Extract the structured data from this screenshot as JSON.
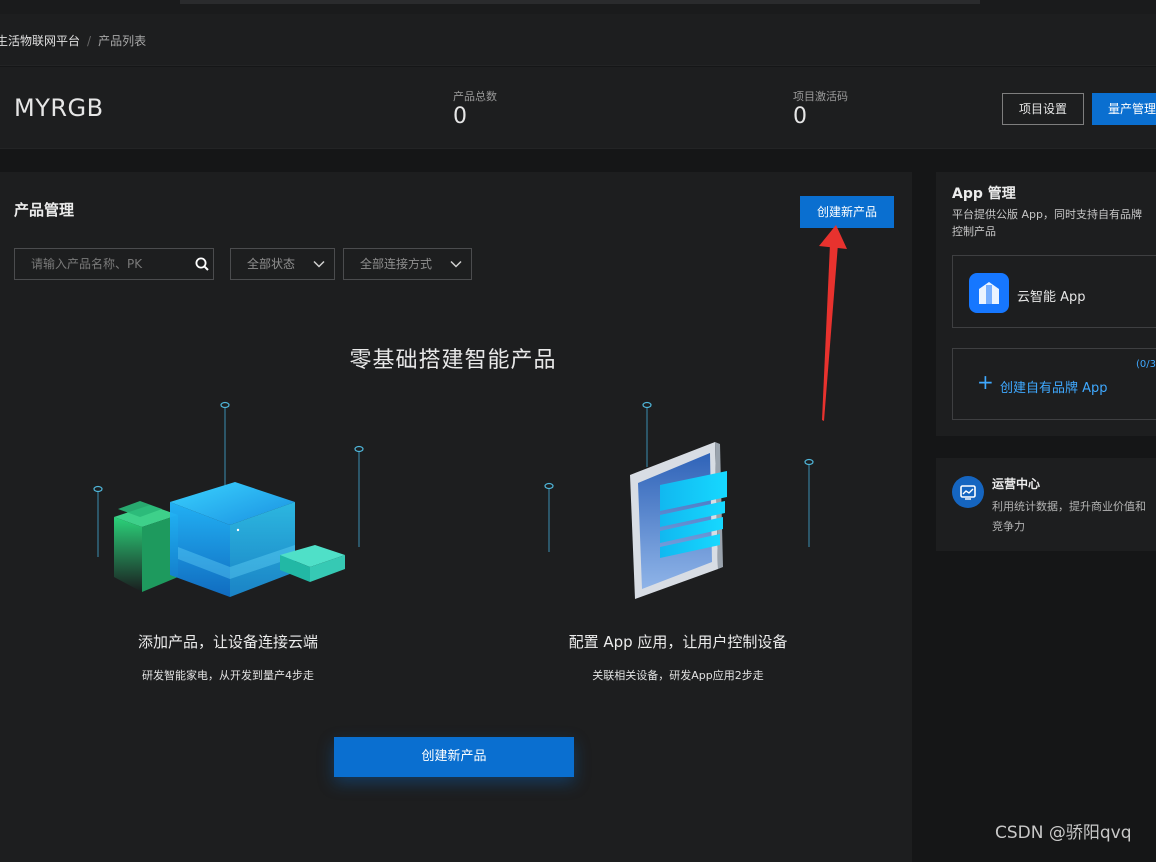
{
  "breadcrumb": {
    "parent": "生活物联网平台",
    "separator": "/",
    "current": "产品列表"
  },
  "header": {
    "project_name": "MYRGB",
    "stats": [
      {
        "label": "产品总数",
        "value": "0"
      },
      {
        "label": "项目激活码",
        "value": "0"
      }
    ],
    "project_settings_label": "项目设置",
    "mass_production_label": "量产管理"
  },
  "product_panel": {
    "title": "产品管理",
    "create_button_label": "创建新产品",
    "search_placeholder": "请输入产品名称、PK",
    "status_filter": "全部状态",
    "connection_filter": "全部连接方式",
    "hero_title": "零基础搭建智能产品",
    "features": [
      {
        "title": "添加产品，让设备连接云端",
        "subtitle": "研发智能家电，从开发到量产4步走"
      },
      {
        "title": "配置 App 应用，让用户控制设备",
        "subtitle": "关联相关设备，研发App应用2步走"
      }
    ],
    "create_big_label": "创建新产品"
  },
  "app_panel": {
    "title": "App 管理",
    "description_line1": "平台提供公版 App，同时支持自有品牌",
    "description_line2": "控制产品",
    "public_app_name": "云智能 App",
    "add_brand_label": "创建自有品牌 App",
    "brand_count": "(0/3"
  },
  "ops_panel": {
    "title": "运营中心",
    "description_line1": "利用统计数据，提升商业价值和",
    "description_line2": "竞争力"
  },
  "watermark": "CSDN @骄阳qvq",
  "colors": {
    "primary": "#0a6fd0",
    "link": "#3fa9ff",
    "annotation_arrow": "#e8322e"
  }
}
